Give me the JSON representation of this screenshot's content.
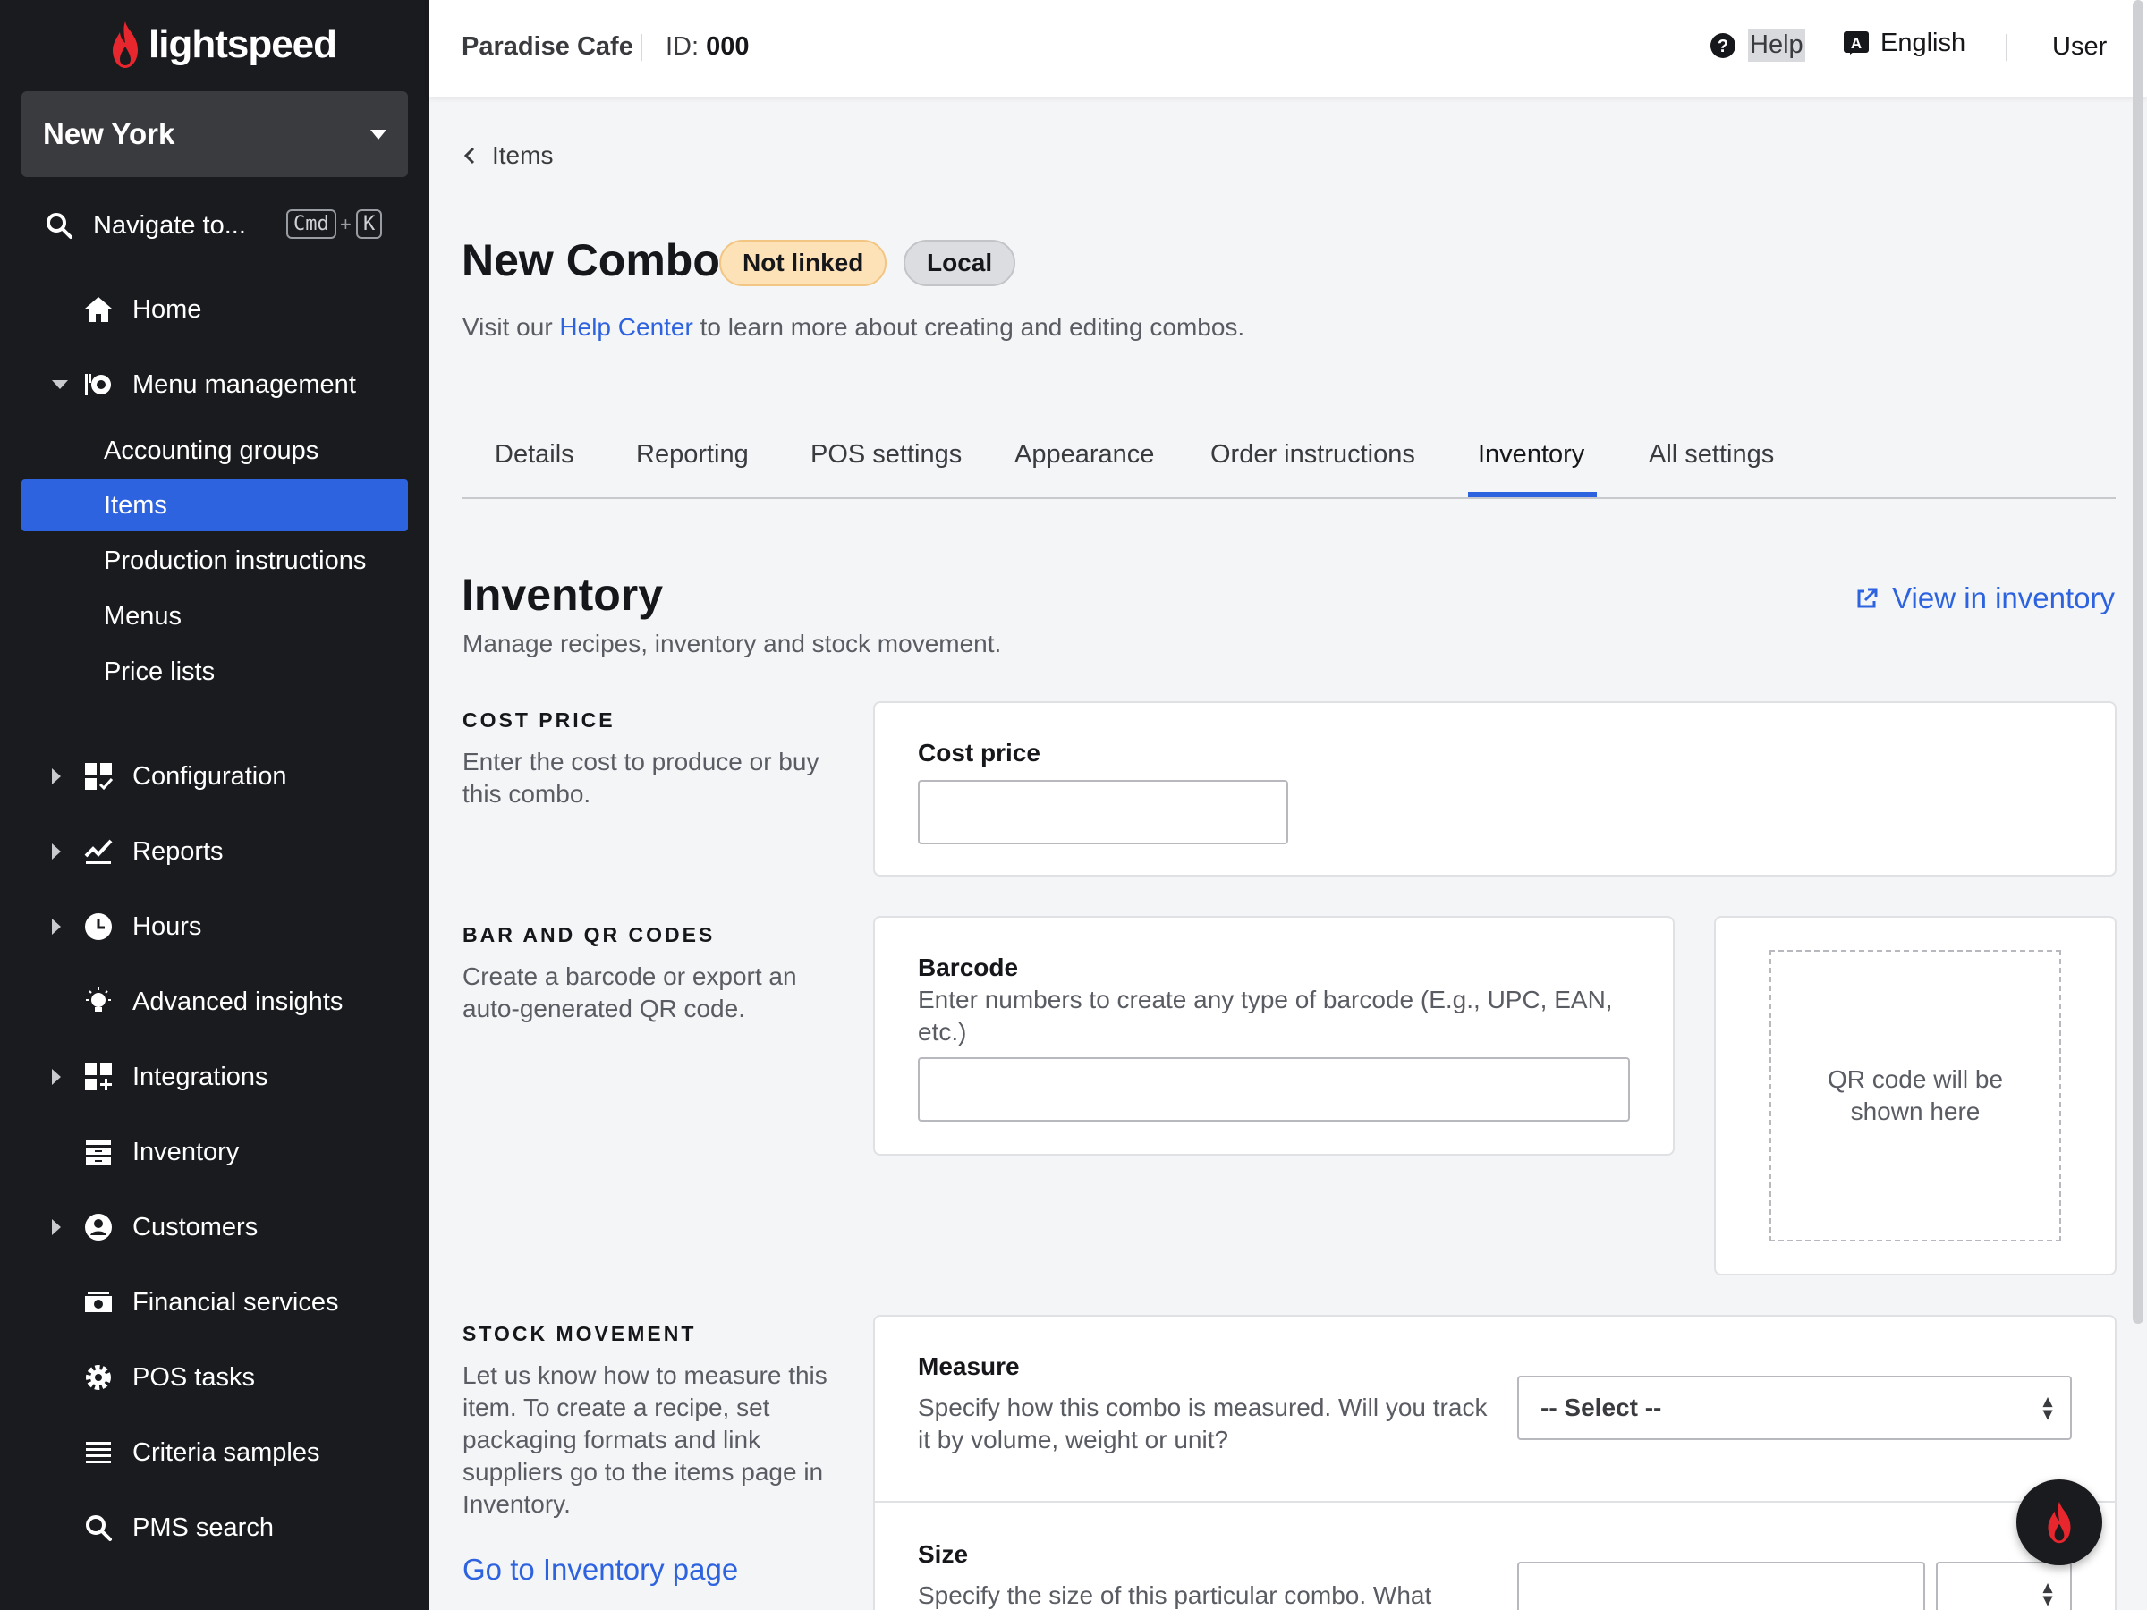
{
  "brand": {
    "logo_text": "lightspeed",
    "accent": "#e8262d",
    "primary": "#2e63e0"
  },
  "sidebar": {
    "location": "New York",
    "navigate": {
      "label": "Navigate to...",
      "shortcut_key1": "Cmd",
      "shortcut_plus": "+",
      "shortcut_key2": "K"
    },
    "home": "Home",
    "menu_management": {
      "label": "Menu management",
      "children": [
        "Accounting groups",
        "Items",
        "Production instructions",
        "Menus",
        "Price lists"
      ],
      "active": "Items"
    },
    "items": [
      {
        "label": "Configuration",
        "expandable": true
      },
      {
        "label": "Reports",
        "expandable": true
      },
      {
        "label": "Hours",
        "expandable": true
      },
      {
        "label": "Advanced insights",
        "expandable": false
      },
      {
        "label": "Integrations",
        "expandable": true
      },
      {
        "label": "Inventory",
        "expandable": false
      },
      {
        "label": "Customers",
        "expandable": true
      },
      {
        "label": "Financial services",
        "expandable": false
      },
      {
        "label": "POS tasks",
        "expandable": false
      },
      {
        "label": "Criteria samples",
        "expandable": false
      },
      {
        "label": "PMS search",
        "expandable": false
      }
    ]
  },
  "topbar": {
    "venue": "Paradise Cafe",
    "id_label": "ID:",
    "id_value": "000",
    "help": "Help",
    "language": "English",
    "user": "User"
  },
  "breadcrumb": "Items",
  "page": {
    "title": "New Combo",
    "badges": [
      "Not linked",
      "Local"
    ],
    "help_prefix": "Visit our",
    "help_link": "Help Center",
    "help_suffix": "to learn more about creating and editing combos."
  },
  "tabs": [
    "Details",
    "Reporting",
    "POS settings",
    "Appearance",
    "Order instructions",
    "Inventory",
    "All settings"
  ],
  "active_tab": "Inventory",
  "inventory": {
    "title": "Inventory",
    "subtitle": "Manage recipes, inventory and stock movement.",
    "view_link": "View in inventory",
    "cost": {
      "heading": "COST PRICE",
      "desc": "Enter the cost to produce or buy this combo.",
      "field_label": "Cost price",
      "value": ""
    },
    "codes": {
      "heading": "BAR AND QR CODES",
      "desc": "Create a barcode or export an auto-generated QR code.",
      "field_label": "Barcode",
      "field_desc": "Enter numbers to create any type of barcode (E.g., UPC, EAN, etc.)",
      "value": "",
      "qr_placeholder": "QR code will be shown here"
    },
    "stock": {
      "heading": "STOCK MOVEMENT",
      "desc": "Let us know how to measure this item. To create a recipe, set packaging formats and link suppliers go to the items page in Inventory.",
      "link": "Go to Inventory page",
      "measure_label": "Measure",
      "measure_desc": "Specify how this combo is measured. Will you track it by volume, weight or unit?",
      "measure_value": "-- Select --",
      "size_label": "Size",
      "size_desc": "Specify the size of this particular combo. What"
    }
  }
}
